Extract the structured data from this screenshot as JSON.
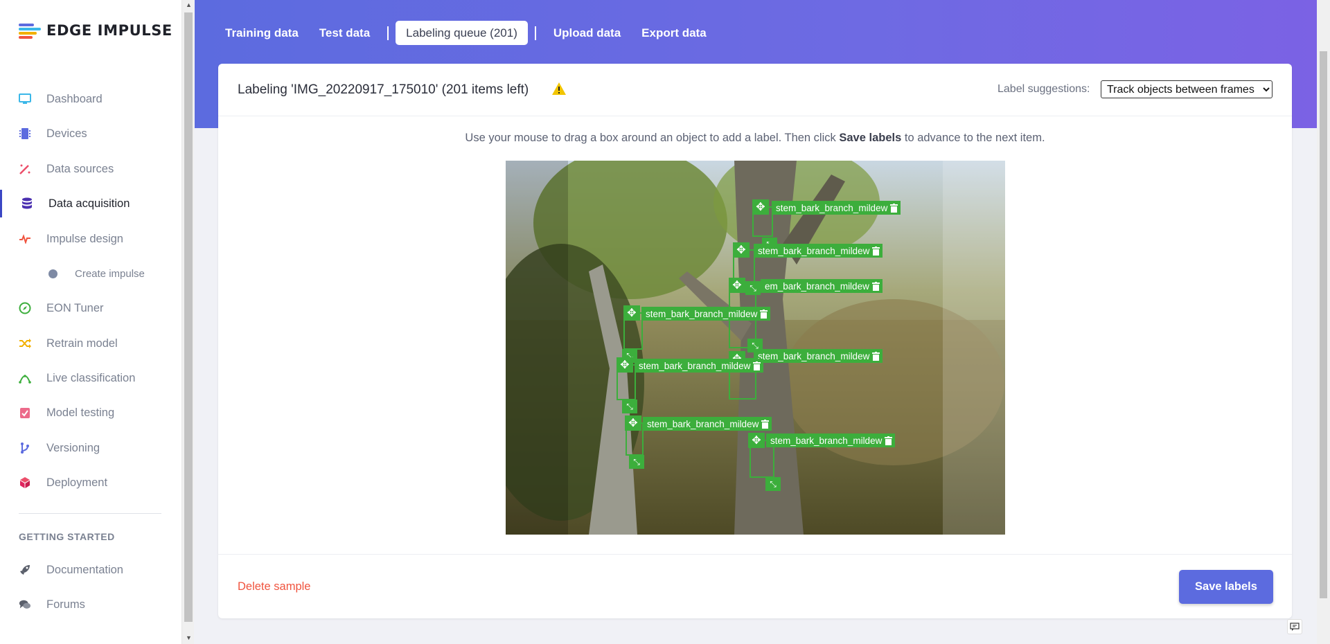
{
  "app": {
    "name": "EDGE IMPULSE"
  },
  "sidebar": {
    "items": [
      {
        "label": "Dashboard",
        "icon": "monitor-icon",
        "color": "#3ab7e8"
      },
      {
        "label": "Devices",
        "icon": "chip-icon",
        "color": "#5c6bdf"
      },
      {
        "label": "Data sources",
        "icon": "wand-icon",
        "color": "#ec4e6a"
      },
      {
        "label": "Data acquisition",
        "icon": "database-icon",
        "color": "#4a2fb0"
      },
      {
        "label": "Impulse design",
        "icon": "pulse-icon",
        "color": "#f0543f"
      },
      {
        "label": "Create impulse",
        "icon": "dot-icon",
        "color": "#7e8aa4"
      },
      {
        "label": "EON Tuner",
        "icon": "compass-icon",
        "color": "#3cae3c"
      },
      {
        "label": "Retrain model",
        "icon": "shuffle-icon",
        "color": "#f2b000"
      },
      {
        "label": "Live classification",
        "icon": "curve-icon",
        "color": "#3cae3c"
      },
      {
        "label": "Model testing",
        "icon": "clipboard-check-icon",
        "color": "#ec6a8a"
      },
      {
        "label": "Versioning",
        "icon": "branch-icon",
        "color": "#5c6bdf"
      },
      {
        "label": "Deployment",
        "icon": "box-icon",
        "color": "#e0245e"
      }
    ],
    "section_title": "GETTING STARTED",
    "help_items": [
      {
        "label": "Documentation",
        "icon": "rocket-icon"
      },
      {
        "label": "Forums",
        "icon": "chat-icon"
      }
    ]
  },
  "tabs": [
    {
      "label": "Training data"
    },
    {
      "label": "Test data"
    },
    {
      "label": "Labeling queue (201)"
    },
    {
      "label": "Upload data"
    },
    {
      "label": "Export data"
    }
  ],
  "labeling": {
    "title": "Labeling 'IMG_20220917_175010' (201 items left)",
    "suggestions_label": "Label suggestions:",
    "suggestions_value": "Track objects between frames",
    "suggestions_options": [
      "Track objects between frames"
    ],
    "instruction_prefix": "Use your mouse to drag a box around an object to add a label. Then click",
    "instruction_bold": "Save labels",
    "instruction_suffix": "to advance to the next item.",
    "boxes": [
      {
        "label": "stem_bark_branch_mildew"
      },
      {
        "label": "stem_bark_branch_mildew"
      },
      {
        "label": "em_bark_branch_mildew"
      },
      {
        "label": "stem_bark_branch_mildew"
      },
      {
        "label": "stem_bark_branch_mildew"
      },
      {
        "label": "stem_bark_branch_mildew"
      },
      {
        "label": "stem_bark_branch_mildew"
      },
      {
        "label": "stem_bark_branch_mildew"
      }
    ]
  },
  "footer": {
    "delete_label": "Delete sample",
    "save_label": "Save labels"
  },
  "colors": {
    "accent": "#5c6bdf",
    "bbox": "#3cae3c",
    "danger": "#f0543f",
    "warning": "#f2c500"
  }
}
